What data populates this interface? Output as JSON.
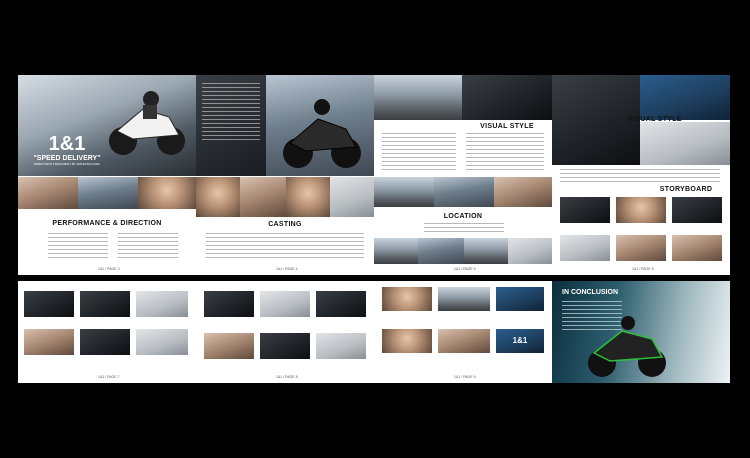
{
  "cover": {
    "logo": "1&1",
    "title": "\"SPEED DELIVERY\"",
    "subtitle": "DIRECTOR'S TREATMENT BY MATEUSZ DUDA"
  },
  "spread1": {
    "heading": "PERFORMANCE & DIRECTION",
    "page_left": "1&1 / PAGE 3",
    "casting_heading": "CASTING",
    "page_right": "1&1 / PAGE 4"
  },
  "spread2": {
    "visual_style_heading": "VISUAL STYLE",
    "location_heading": "LOCATION",
    "page_left": "1&1 / PAGE 5",
    "visual_style_heading_right": "VISUAL STYLE",
    "storyboard_heading": "STORYBOARD",
    "page_right": "1&1 / PAGE 6"
  },
  "row2": {
    "conclusion_heading": "IN CONCLUSION",
    "page7": "1&1 / PAGE 7",
    "page8": "1&1 / PAGE 8",
    "page9": "1&1 / PAGE 9",
    "logo_small": "1&1"
  },
  "colors": {
    "background": "#000000",
    "page": "#ffffff",
    "accent": "#1c4b7a"
  }
}
